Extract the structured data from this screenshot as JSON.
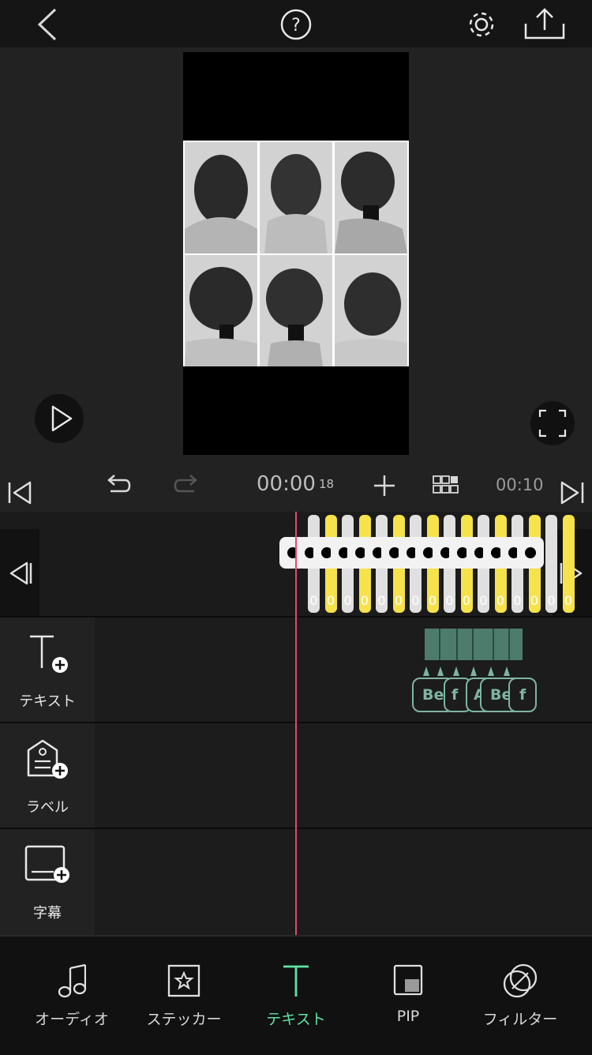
{
  "header": {
    "back": "back-icon",
    "help": "help-icon",
    "settings": "gear-icon",
    "export": "export-icon"
  },
  "timecode": {
    "current": "00:00",
    "frame": "18",
    "total": "00:10"
  },
  "clips": {
    "numbers": [
      "0",
      "0",
      "0",
      "0",
      "0",
      "0",
      "0",
      "0",
      "0",
      "0",
      "0",
      "0",
      "0",
      "0",
      "0",
      "0"
    ]
  },
  "tracks": {
    "text": {
      "label": "テキスト",
      "chips": [
        "Be",
        "f",
        "A",
        "Be",
        "f"
      ]
    },
    "label": {
      "label": "ラベル"
    },
    "subtitle": {
      "label": "字幕"
    }
  },
  "tabs": [
    {
      "label": "オーディオ",
      "icon": "music-note-icon"
    },
    {
      "label": "ステッカー",
      "icon": "sticker-icon"
    },
    {
      "label": "テキスト",
      "icon": "text-icon",
      "active": true
    },
    {
      "label": "PIP",
      "icon": "pip-icon"
    },
    {
      "label": "フィルター",
      "icon": "filter-icon"
    }
  ],
  "colors": {
    "accent": "#5fe2a6",
    "playhead": "#e8476a",
    "chip": "#7fb4a2",
    "clip_yellow": "#f6e24a"
  }
}
